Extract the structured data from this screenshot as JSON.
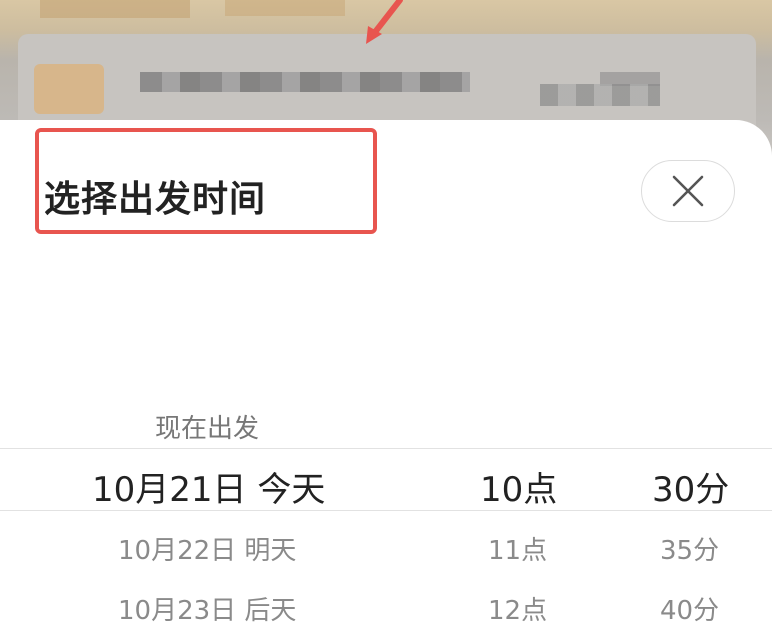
{
  "dialog": {
    "title": "选择出发时间",
    "close_icon": "close-icon",
    "now_option": "现在出发"
  },
  "picker": {
    "rows": [
      {
        "date": "10月21日 今天",
        "hour": "10点",
        "minute": "30分",
        "selected": true
      },
      {
        "date": "10月22日 明天",
        "hour": "11点",
        "minute": "35分",
        "selected": false
      },
      {
        "date": "10月23日 后天",
        "hour": "12点",
        "minute": "40分",
        "selected": false
      }
    ]
  },
  "annotation": {
    "highlight_color": "#e8554f"
  }
}
